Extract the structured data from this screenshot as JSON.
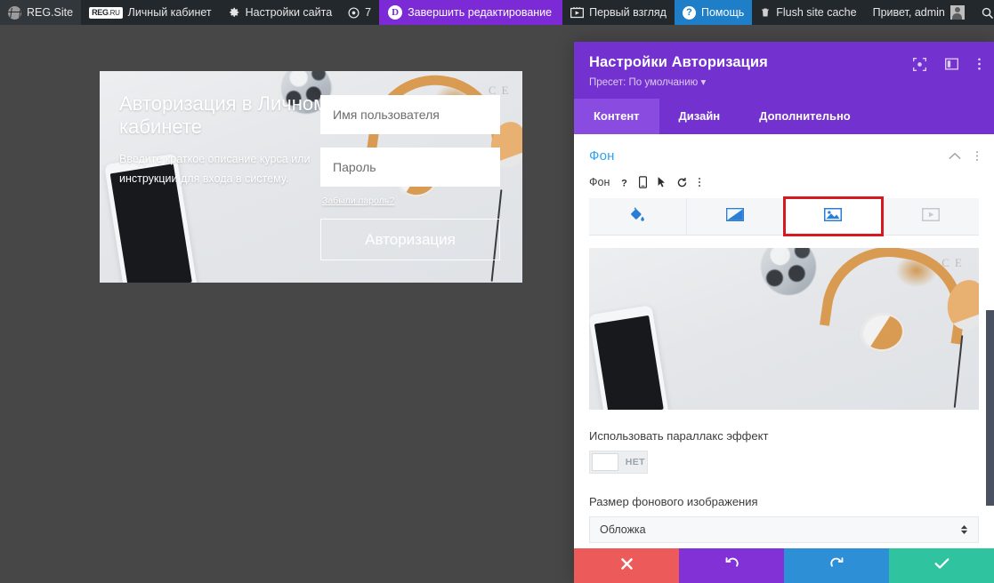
{
  "adminbar": {
    "items": [
      {
        "id": "wp-logo",
        "icon": "wordpress-icon",
        "label": "REG.Site"
      },
      {
        "id": "regru",
        "icon": "regru-badge-icon",
        "label": "Личный кабинет"
      },
      {
        "id": "site-opts",
        "icon": "gear-icon",
        "label": "Настройки сайта"
      },
      {
        "id": "views",
        "icon": "eye-icon",
        "label": "7"
      },
      {
        "id": "divi-exit",
        "icon": "divi-icon",
        "label": "Завершить редактирование"
      },
      {
        "id": "first-look",
        "icon": "screen-icon",
        "label": "Первый взгляд"
      },
      {
        "id": "help",
        "icon": "question-icon",
        "label": "Помощь"
      },
      {
        "id": "flush",
        "icon": "trash-icon",
        "label": "Flush site cache"
      },
      {
        "id": "account",
        "icon": "avatar-icon",
        "label": "Привет, admin"
      },
      {
        "id": "search",
        "icon": "search-icon",
        "label": ""
      }
    ]
  },
  "preview": {
    "title": "Авторизация в Личном кабинете",
    "description": "Введите краткое описание курса или инструкции для входа в систему.",
    "username_placeholder": "Имя пользователя",
    "password_placeholder": "Пароль",
    "forgot_link": "Забыли пароль?",
    "submit_label": "Авторизация"
  },
  "panel": {
    "title": "Настройки Авторизация",
    "preset": "Пресет: По умолчанию",
    "header_icons": [
      "focus-icon",
      "layout-icon",
      "kebab-menu-icon"
    ],
    "tabs": [
      {
        "label": "Контент",
        "active": true
      },
      {
        "label": "Дизайн",
        "active": false
      },
      {
        "label": "Дополнительно",
        "active": false
      }
    ],
    "section": {
      "title": "Фон",
      "collapse_icon": "chevron-up-icon",
      "menu_icon": "kebab-menu-icon",
      "field_label": "Фон",
      "field_icons": [
        "question-icon",
        "responsive-icon",
        "hover-icon",
        "reset-icon",
        "kebab-menu-icon"
      ],
      "bg_type_tabs": [
        {
          "name": "color-fill-icon",
          "active": false,
          "selected": false,
          "disabled": false
        },
        {
          "name": "gradient-icon",
          "active": false,
          "selected": false,
          "disabled": false
        },
        {
          "name": "image-icon",
          "active": true,
          "selected": true,
          "disabled": false
        },
        {
          "name": "video-icon",
          "active": false,
          "selected": false,
          "disabled": true
        }
      ],
      "parallax_label": "Использовать параллакс эффект",
      "parallax_value": "НЕТ",
      "bgsize_label": "Размер фонового изображения",
      "bgsize_value": "Обложка"
    },
    "footer_buttons": [
      {
        "name": "cancel-button",
        "icon": "close-icon",
        "color": "#ed5a5a"
      },
      {
        "name": "undo-button",
        "icon": "undo-icon",
        "color": "#8231d6"
      },
      {
        "name": "redo-button",
        "icon": "redo-icon",
        "color": "#2d8fd5"
      },
      {
        "name": "save-button",
        "icon": "check-icon",
        "color": "#30c3a0"
      }
    ]
  },
  "colors": {
    "adminbar_bg": "#23282d",
    "panel_purple": "#7332cf",
    "tab_active": "#8a4be0",
    "accent_blue": "#2ea3f2",
    "selection_outline": "#d6191e",
    "canvas_bg": "#474747"
  }
}
